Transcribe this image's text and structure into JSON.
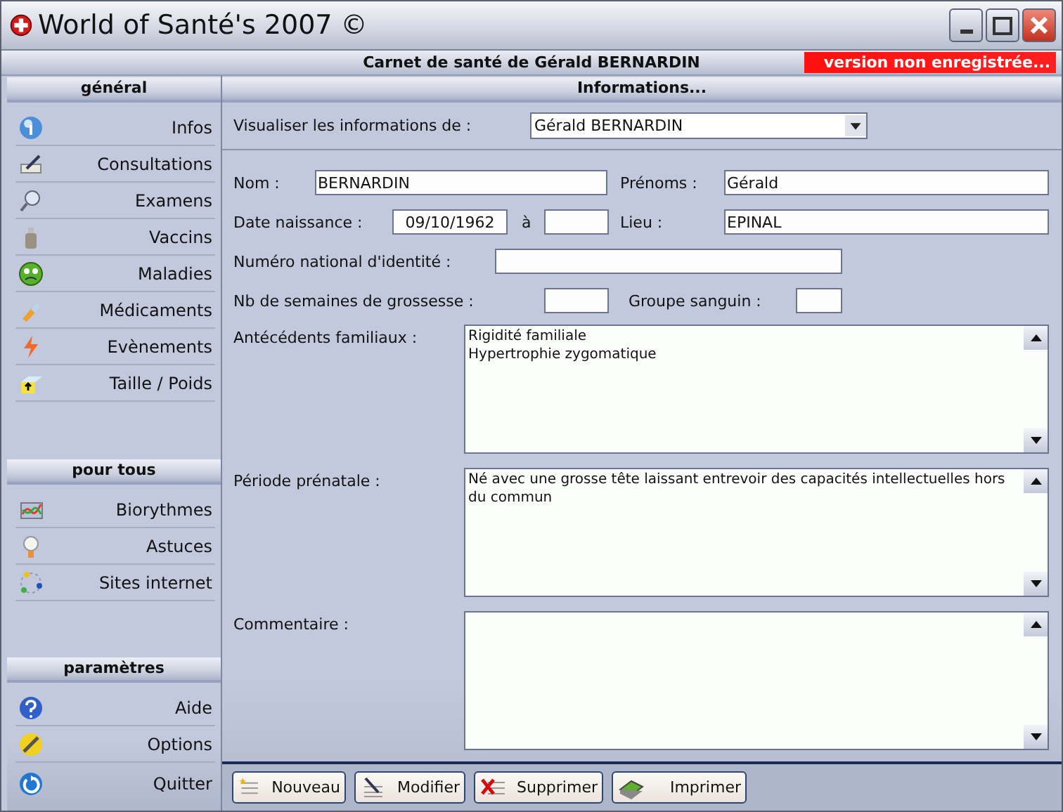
{
  "window": {
    "title": "World of Santé's 2007 ©"
  },
  "header": {
    "title": "Carnet de santé de Gérald BERNARDIN",
    "badge": "version non enregistrée..."
  },
  "sidebar": {
    "sections": [
      {
        "title": "général",
        "items": [
          {
            "label": "Infos"
          },
          {
            "label": "Consultations"
          },
          {
            "label": "Examens"
          },
          {
            "label": "Vaccins"
          },
          {
            "label": "Maladies"
          },
          {
            "label": "Médicaments"
          },
          {
            "label": "Evènements"
          },
          {
            "label": "Taille / Poids"
          }
        ]
      },
      {
        "title": "pour tous",
        "items": [
          {
            "label": "Biorythmes"
          },
          {
            "label": "Astuces"
          },
          {
            "label": "Sites internet"
          }
        ]
      },
      {
        "title": "paramètres",
        "items": [
          {
            "label": "Aide"
          },
          {
            "label": "Options"
          },
          {
            "label": "Quitter"
          }
        ]
      }
    ]
  },
  "panel": {
    "title": "Informations...",
    "selector": {
      "label": "Visualiser les informations de :",
      "value": "Gérald BERNARDIN"
    },
    "fields": [
      {
        "label": "Nom :",
        "value": "BERNARDIN"
      },
      {
        "label": "Prénoms :",
        "value": "Gérald"
      },
      {
        "label": "Date naissance :",
        "value": "09/10/1962"
      },
      {
        "label": "à"
      },
      {
        "label": "Lieu :",
        "value": "EPINAL"
      },
      {
        "label": "Numéro national d'identité :"
      },
      {
        "label": "Nb de semaines de grossesse :"
      },
      {
        "label": "Groupe sanguin :"
      }
    ],
    "notes": [
      {
        "label": "Antécédents familiaux :",
        "lines": [
          "Rigidité familiale",
          "Hypertrophie zygomatique"
        ]
      },
      {
        "label": "Période prénatale :",
        "lines": [
          "Né avec une grosse tête laissant entrevoir des capacités intellectuelles hors du commun"
        ]
      },
      {
        "label": "Commentaire :"
      }
    ]
  },
  "buttons": [
    {
      "label": "Nouveau"
    },
    {
      "label": "Modifier"
    },
    {
      "label": "Supprimer"
    },
    {
      "label": "Imprimer"
    }
  ]
}
